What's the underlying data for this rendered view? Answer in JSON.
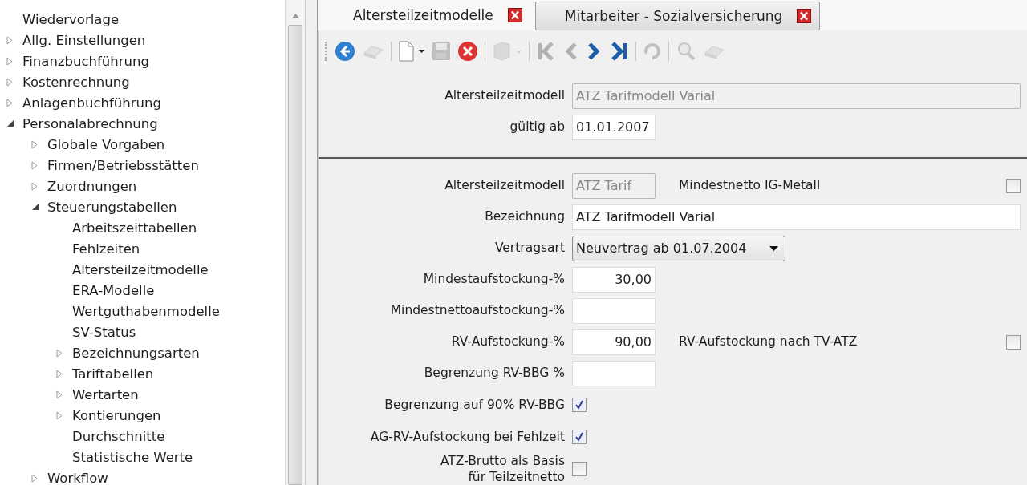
{
  "tree": [
    {
      "label": "Wiedervorlage"
    },
    {
      "label": "Allg. Einstellungen",
      "expanded": false
    },
    {
      "label": "Finanzbuchführung",
      "expanded": false
    },
    {
      "label": "Kostenrechnung",
      "expanded": false
    },
    {
      "label": "Anlagenbuchführung",
      "expanded": false
    },
    {
      "label": "Personalabrechnung",
      "expanded": true,
      "children": [
        {
          "label": "Globale Vorgaben",
          "expanded": false
        },
        {
          "label": "Firmen/Betriebsstätten",
          "expanded": false
        },
        {
          "label": "Zuordnungen",
          "expanded": false
        },
        {
          "label": "Steuerungstabellen",
          "expanded": true,
          "children": [
            {
              "label": "Arbeitszeittabellen"
            },
            {
              "label": "Fehlzeiten"
            },
            {
              "label": "Altersteilzeitmodelle"
            },
            {
              "label": "ERA-Modelle"
            },
            {
              "label": "Wertguthabenmodelle"
            },
            {
              "label": "SV-Status"
            },
            {
              "label": "Bezeichnungsarten",
              "expanded": false
            },
            {
              "label": "Tariftabellen",
              "expanded": false
            },
            {
              "label": "Wertarten",
              "expanded": false
            },
            {
              "label": "Kontierungen",
              "expanded": false
            },
            {
              "label": "Durchschnitte"
            },
            {
              "label": "Statistische Werte"
            }
          ]
        },
        {
          "label": "Workflow",
          "expanded": false
        }
      ]
    }
  ],
  "tabs": [
    {
      "label": "Altersteilzeitmodelle",
      "selected": true
    },
    {
      "label": "Mitarbeiter - Sozialversicherung",
      "selected": false
    }
  ],
  "toolbar": [
    {
      "kind": "back",
      "disabled": false
    },
    {
      "kind": "open",
      "disabled": true
    },
    {
      "kind": "sep"
    },
    {
      "kind": "new",
      "disabled": false
    },
    {
      "kind": "save",
      "disabled": true
    },
    {
      "kind": "delete",
      "disabled": false
    },
    {
      "kind": "sep"
    },
    {
      "kind": "print",
      "disabled": true
    },
    {
      "kind": "sep"
    },
    {
      "kind": "first",
      "disabled": true
    },
    {
      "kind": "prev",
      "disabled": true
    },
    {
      "kind": "next",
      "disabled": false
    },
    {
      "kind": "last",
      "disabled": false
    },
    {
      "kind": "sep"
    },
    {
      "kind": "refresh",
      "disabled": true
    },
    {
      "kind": "sep"
    },
    {
      "kind": "find",
      "disabled": true
    },
    {
      "kind": "erase",
      "disabled": true
    }
  ],
  "header": [
    {
      "label": "Altersteilzeitmodell",
      "kind": "long",
      "value": "ATZ Tarifmodell Varial",
      "disabled": true
    },
    {
      "label": "gültig ab",
      "kind": "text",
      "value": "01.01.2007",
      "disabled": false
    }
  ],
  "form": [
    {
      "label": "Altersteilzeitmodell",
      "kind": "text",
      "value": "ATZ Tarif",
      "disabled": true,
      "side": {
        "label": "Mindestnetto IG-Metall",
        "checked": false
      }
    },
    {
      "label": "Bezeichnung",
      "kind": "long",
      "value": "ATZ Tarifmodell Varial",
      "disabled": false
    },
    {
      "label": "Vertragsart",
      "kind": "select",
      "value": "Neuvertrag ab 01.07.2004"
    },
    {
      "label": "Mindestaufstockung-%",
      "kind": "number",
      "value": "30,00"
    },
    {
      "label": "Mindestnettoaufstockung-%",
      "kind": "number"
    },
    {
      "label": "RV-Aufstockung-%",
      "kind": "number",
      "value": "90,00",
      "side": {
        "label": "RV-Aufstockung nach TV-ATZ",
        "checked": false
      }
    },
    {
      "label": "Begrenzung RV-BBG %",
      "kind": "number"
    },
    {
      "label": "Begrenzung auf 90% RV-BBG",
      "kind": "checkbox",
      "checked": true
    },
    {
      "label": "AG-RV-Aufstockung bei Fehlzeit",
      "kind": "checkbox",
      "checked": true
    },
    {
      "label": "ATZ-Brutto als Basis\nfür Teilzeitnetto",
      "kind": "checkbox",
      "checked": false
    }
  ]
}
